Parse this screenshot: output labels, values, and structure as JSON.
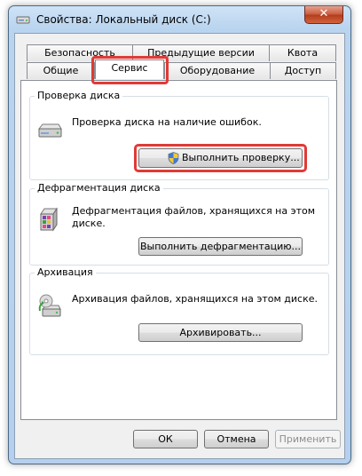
{
  "window": {
    "title": "Свойства: Локальный диск (C:)",
    "close_glyph": "✕"
  },
  "tabs": {
    "row1": [
      "Безопасность",
      "Предыдущие версии",
      "Квота"
    ],
    "row2": [
      "Общие",
      "Сервис",
      "Оборудование",
      "Доступ"
    ],
    "active": "Сервис"
  },
  "groups": {
    "check": {
      "title": "Проверка диска",
      "text": "Проверка диска на наличие ошибок.",
      "button": "Выполнить проверку...",
      "icon": "drive-icon"
    },
    "defrag": {
      "title": "Дефрагментация диска",
      "text_line1": "Дефрагментация файлов, хранящихся на этом",
      "text_line2": "диске.",
      "button": "Выполнить дефрагментацию...",
      "icon": "defrag-icon"
    },
    "backup": {
      "title": "Архивация",
      "text": "Архивация файлов, хранящихся на этом диске.",
      "button": "Архивировать...",
      "icon": "backup-icon"
    }
  },
  "footer": {
    "ok": "ОК",
    "cancel": "Отмена",
    "apply": "Применить"
  },
  "colors": {
    "highlight": "#e13a36",
    "close_button": "#c75a3c"
  }
}
